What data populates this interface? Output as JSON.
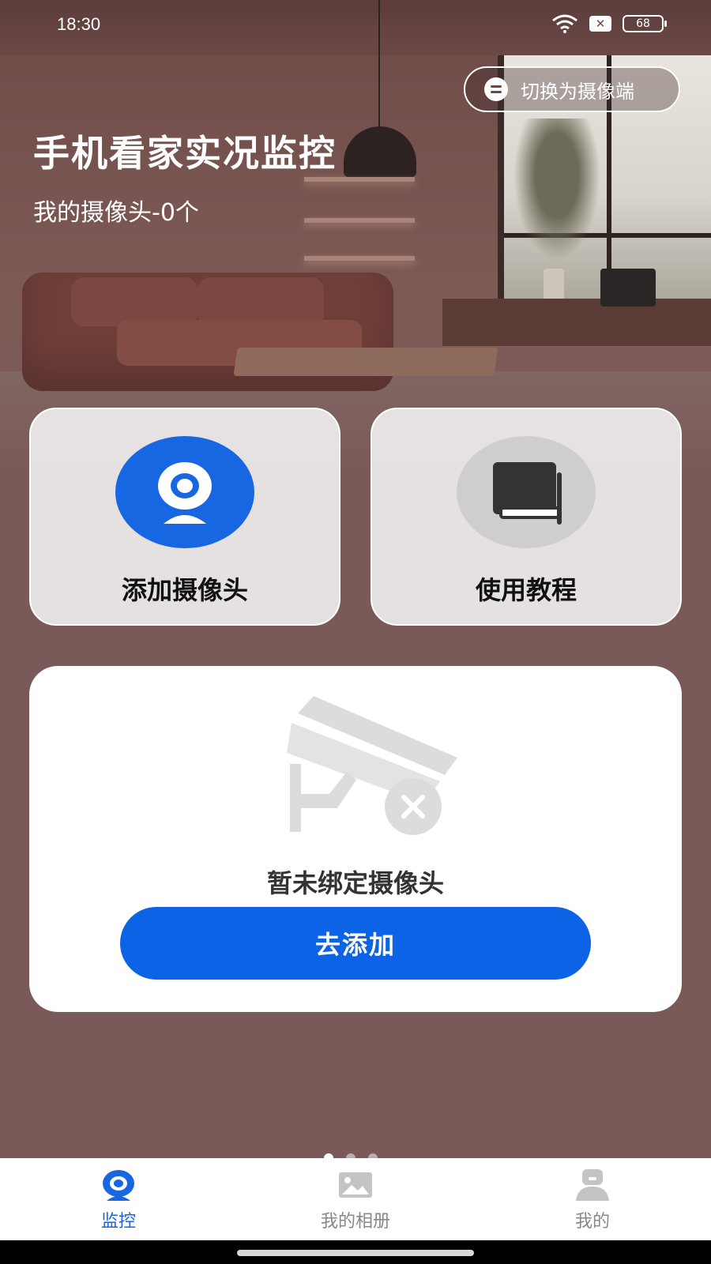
{
  "status_bar": {
    "time": "18:30",
    "battery": "68",
    "x_badge": "✕"
  },
  "header": {
    "switch_label": "切换为摄像端",
    "title": "手机看家实况监控",
    "subtitle": "我的摄像头-0个"
  },
  "actions": {
    "add_camera": "添加摄像头",
    "tutorial": "使用教程"
  },
  "empty_state": {
    "message": "暂未绑定摄像头",
    "button": "去添加"
  },
  "bottom_nav": {
    "items": [
      {
        "label": "监控",
        "icon": "webcam-icon",
        "active": true
      },
      {
        "label": "我的相册",
        "icon": "picture-icon",
        "active": false
      },
      {
        "label": "我的",
        "icon": "profile-icon",
        "active": false
      }
    ]
  },
  "colors": {
    "accent": "#1766e2",
    "button": "#0d63e5",
    "background": "#7a5a58"
  }
}
